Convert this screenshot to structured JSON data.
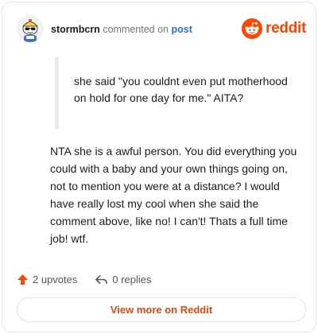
{
  "header": {
    "username": "stormbcrn",
    "commented_on": "commented on",
    "post_link": "post",
    "avatar_icon": "snoo-avatar-icon"
  },
  "brand": {
    "logo_icon": "reddit-snoo-icon",
    "wordmark": "reddit",
    "color": "#ff4500"
  },
  "comment": {
    "quote": "she said \"you couldnt even put motherhood on hold for one day for me.\" AITA?",
    "body": "NTA she is a awful person. You did everything you could with a baby and your own things going on, not to mention you were at a distance? I would have really lost my cool when she said the comment above, like no! I can't! Thats a full time job! wtf."
  },
  "actions": {
    "upvotes": "2 upvotes",
    "replies": "0 replies",
    "upvote_icon": "upvote-arrow-icon",
    "reply_icon": "reply-arrow-icon",
    "upvote_color": "#ff4500"
  },
  "footer": {
    "view_more": "View more on Reddit",
    "link_color": "#d9480f"
  }
}
